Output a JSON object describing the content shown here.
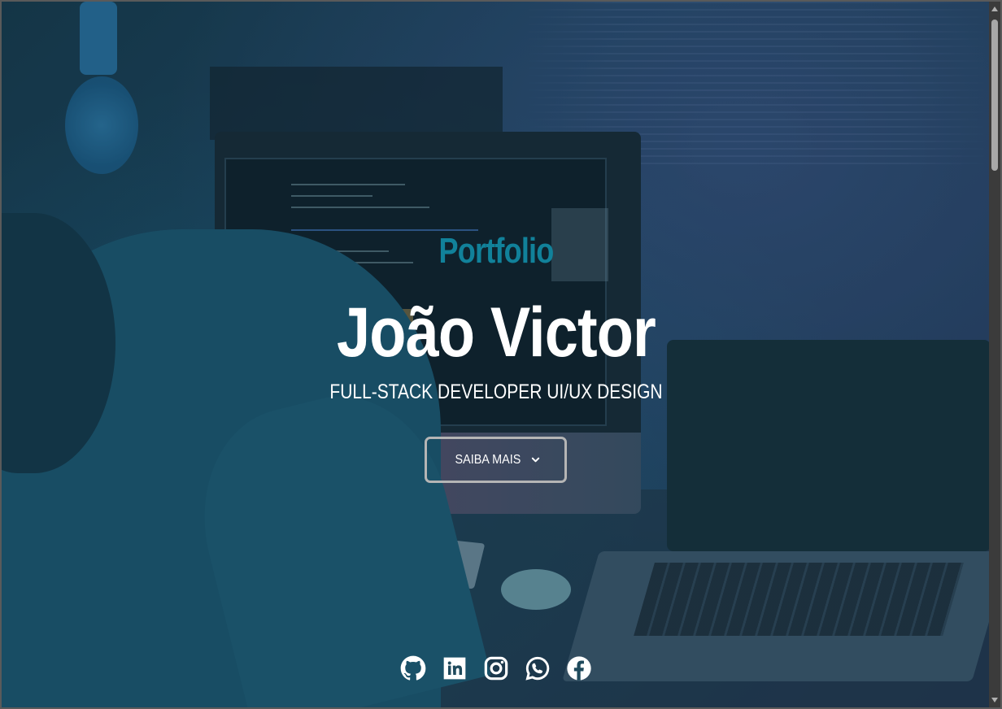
{
  "hero": {
    "eyebrow": "Portfolio",
    "name": "João Victor",
    "role": "FULL-STACK DEVELOPER UI/UX DESIGN",
    "cta_label": "SAIBA MAIS",
    "cta_icon": "chevron-down-icon"
  },
  "socials": [
    {
      "icon": "github-icon"
    },
    {
      "icon": "linkedin-icon"
    },
    {
      "icon": "instagram-icon"
    },
    {
      "icon": "whatsapp-icon"
    },
    {
      "icon": "facebook-icon"
    }
  ],
  "colors": {
    "accent": "#11819a",
    "text": "#ffffff",
    "button_border": "#b5b5b5"
  }
}
